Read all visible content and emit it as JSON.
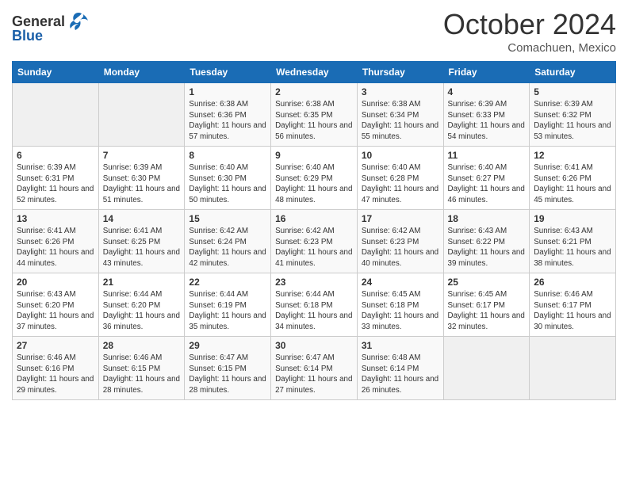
{
  "header": {
    "logo": {
      "general": "General",
      "blue": "Blue"
    },
    "title": "October 2024",
    "location": "Comachuen, Mexico"
  },
  "calendar": {
    "weekdays": [
      "Sunday",
      "Monday",
      "Tuesday",
      "Wednesday",
      "Thursday",
      "Friday",
      "Saturday"
    ],
    "weeks": [
      [
        {
          "day": "",
          "empty": true
        },
        {
          "day": "",
          "empty": true
        },
        {
          "day": "1",
          "sunrise": "Sunrise: 6:38 AM",
          "sunset": "Sunset: 6:36 PM",
          "daylight": "Daylight: 11 hours and 57 minutes."
        },
        {
          "day": "2",
          "sunrise": "Sunrise: 6:38 AM",
          "sunset": "Sunset: 6:35 PM",
          "daylight": "Daylight: 11 hours and 56 minutes."
        },
        {
          "day": "3",
          "sunrise": "Sunrise: 6:38 AM",
          "sunset": "Sunset: 6:34 PM",
          "daylight": "Daylight: 11 hours and 55 minutes."
        },
        {
          "day": "4",
          "sunrise": "Sunrise: 6:39 AM",
          "sunset": "Sunset: 6:33 PM",
          "daylight": "Daylight: 11 hours and 54 minutes."
        },
        {
          "day": "5",
          "sunrise": "Sunrise: 6:39 AM",
          "sunset": "Sunset: 6:32 PM",
          "daylight": "Daylight: 11 hours and 53 minutes."
        }
      ],
      [
        {
          "day": "6",
          "sunrise": "Sunrise: 6:39 AM",
          "sunset": "Sunset: 6:31 PM",
          "daylight": "Daylight: 11 hours and 52 minutes."
        },
        {
          "day": "7",
          "sunrise": "Sunrise: 6:39 AM",
          "sunset": "Sunset: 6:30 PM",
          "daylight": "Daylight: 11 hours and 51 minutes."
        },
        {
          "day": "8",
          "sunrise": "Sunrise: 6:40 AM",
          "sunset": "Sunset: 6:30 PM",
          "daylight": "Daylight: 11 hours and 50 minutes."
        },
        {
          "day": "9",
          "sunrise": "Sunrise: 6:40 AM",
          "sunset": "Sunset: 6:29 PM",
          "daylight": "Daylight: 11 hours and 48 minutes."
        },
        {
          "day": "10",
          "sunrise": "Sunrise: 6:40 AM",
          "sunset": "Sunset: 6:28 PM",
          "daylight": "Daylight: 11 hours and 47 minutes."
        },
        {
          "day": "11",
          "sunrise": "Sunrise: 6:40 AM",
          "sunset": "Sunset: 6:27 PM",
          "daylight": "Daylight: 11 hours and 46 minutes."
        },
        {
          "day": "12",
          "sunrise": "Sunrise: 6:41 AM",
          "sunset": "Sunset: 6:26 PM",
          "daylight": "Daylight: 11 hours and 45 minutes."
        }
      ],
      [
        {
          "day": "13",
          "sunrise": "Sunrise: 6:41 AM",
          "sunset": "Sunset: 6:26 PM",
          "daylight": "Daylight: 11 hours and 44 minutes."
        },
        {
          "day": "14",
          "sunrise": "Sunrise: 6:41 AM",
          "sunset": "Sunset: 6:25 PM",
          "daylight": "Daylight: 11 hours and 43 minutes."
        },
        {
          "day": "15",
          "sunrise": "Sunrise: 6:42 AM",
          "sunset": "Sunset: 6:24 PM",
          "daylight": "Daylight: 11 hours and 42 minutes."
        },
        {
          "day": "16",
          "sunrise": "Sunrise: 6:42 AM",
          "sunset": "Sunset: 6:23 PM",
          "daylight": "Daylight: 11 hours and 41 minutes."
        },
        {
          "day": "17",
          "sunrise": "Sunrise: 6:42 AM",
          "sunset": "Sunset: 6:23 PM",
          "daylight": "Daylight: 11 hours and 40 minutes."
        },
        {
          "day": "18",
          "sunrise": "Sunrise: 6:43 AM",
          "sunset": "Sunset: 6:22 PM",
          "daylight": "Daylight: 11 hours and 39 minutes."
        },
        {
          "day": "19",
          "sunrise": "Sunrise: 6:43 AM",
          "sunset": "Sunset: 6:21 PM",
          "daylight": "Daylight: 11 hours and 38 minutes."
        }
      ],
      [
        {
          "day": "20",
          "sunrise": "Sunrise: 6:43 AM",
          "sunset": "Sunset: 6:20 PM",
          "daylight": "Daylight: 11 hours and 37 minutes."
        },
        {
          "day": "21",
          "sunrise": "Sunrise: 6:44 AM",
          "sunset": "Sunset: 6:20 PM",
          "daylight": "Daylight: 11 hours and 36 minutes."
        },
        {
          "day": "22",
          "sunrise": "Sunrise: 6:44 AM",
          "sunset": "Sunset: 6:19 PM",
          "daylight": "Daylight: 11 hours and 35 minutes."
        },
        {
          "day": "23",
          "sunrise": "Sunrise: 6:44 AM",
          "sunset": "Sunset: 6:18 PM",
          "daylight": "Daylight: 11 hours and 34 minutes."
        },
        {
          "day": "24",
          "sunrise": "Sunrise: 6:45 AM",
          "sunset": "Sunset: 6:18 PM",
          "daylight": "Daylight: 11 hours and 33 minutes."
        },
        {
          "day": "25",
          "sunrise": "Sunrise: 6:45 AM",
          "sunset": "Sunset: 6:17 PM",
          "daylight": "Daylight: 11 hours and 32 minutes."
        },
        {
          "day": "26",
          "sunrise": "Sunrise: 6:46 AM",
          "sunset": "Sunset: 6:17 PM",
          "daylight": "Daylight: 11 hours and 30 minutes."
        }
      ],
      [
        {
          "day": "27",
          "sunrise": "Sunrise: 6:46 AM",
          "sunset": "Sunset: 6:16 PM",
          "daylight": "Daylight: 11 hours and 29 minutes."
        },
        {
          "day": "28",
          "sunrise": "Sunrise: 6:46 AM",
          "sunset": "Sunset: 6:15 PM",
          "daylight": "Daylight: 11 hours and 28 minutes."
        },
        {
          "day": "29",
          "sunrise": "Sunrise: 6:47 AM",
          "sunset": "Sunset: 6:15 PM",
          "daylight": "Daylight: 11 hours and 28 minutes."
        },
        {
          "day": "30",
          "sunrise": "Sunrise: 6:47 AM",
          "sunset": "Sunset: 6:14 PM",
          "daylight": "Daylight: 11 hours and 27 minutes."
        },
        {
          "day": "31",
          "sunrise": "Sunrise: 6:48 AM",
          "sunset": "Sunset: 6:14 PM",
          "daylight": "Daylight: 11 hours and 26 minutes."
        },
        {
          "day": "",
          "empty": true
        },
        {
          "day": "",
          "empty": true
        }
      ]
    ]
  }
}
